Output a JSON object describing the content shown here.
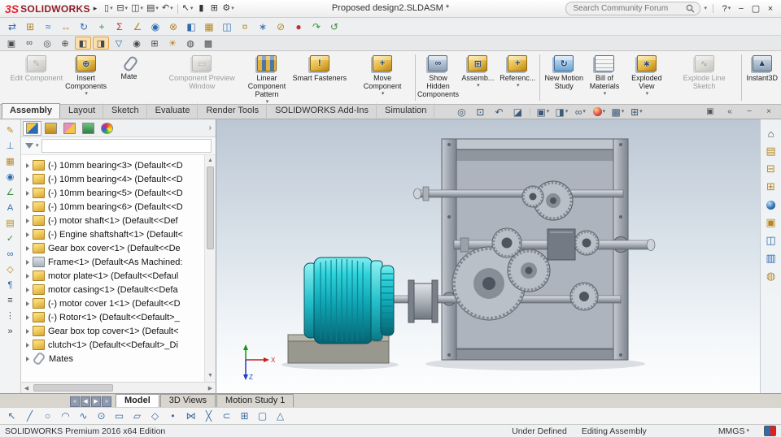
{
  "colors": {
    "accent_red": "#d6202e",
    "motor_teal": "#14b4c0",
    "housing_gray": "#adb4bd",
    "base_gray": "#98988f",
    "viewport_top": "#bcc7d4",
    "viewport_bottom": "#fdfefe"
  },
  "ui": {
    "caret": "▾",
    "chevron": "›"
  },
  "titlebar": {
    "logo": "3S",
    "brand": "SOLIDWORKS",
    "dock_arrow": "▸",
    "title": "Proposed design2.SLDASM *",
    "search_placeholder": "Search Community Forum",
    "quick_icons": [
      {
        "name": "new-icon",
        "glyph": "▯",
        "dd": true
      },
      {
        "name": "open-icon",
        "glyph": "⊟",
        "dd": true
      },
      {
        "name": "save-icon",
        "glyph": "◫",
        "dd": true
      },
      {
        "name": "print-icon",
        "glyph": "▤",
        "dd": true
      },
      {
        "name": "undo-icon",
        "glyph": "↶",
        "dd": true
      },
      {
        "sep": true
      },
      {
        "name": "select-icon",
        "glyph": "↖",
        "dd": true
      },
      {
        "name": "xpress-products-icon",
        "glyph": "▮",
        "mod": "c-dark"
      },
      {
        "name": "display-grid-icon",
        "glyph": "⊞"
      },
      {
        "name": "options-icon",
        "glyph": "⚙",
        "dd": true
      }
    ],
    "search_caret": "▾",
    "window_controls": [
      {
        "name": "help-icon",
        "glyph": "?",
        "dd": true
      },
      {
        "name": "minimize-icon",
        "glyph": "−"
      },
      {
        "name": "maximize-icon",
        "glyph": "▢"
      },
      {
        "name": "close-icon",
        "glyph": "×"
      }
    ]
  },
  "toolbar2": {
    "icons": [
      {
        "name": "swap-component-icon",
        "glyph": "⇄",
        "mod": "c-blue"
      },
      {
        "name": "insert-component-tb-icon",
        "glyph": "⊞",
        "mod": "c-gold"
      },
      {
        "name": "mate-tb-icon",
        "glyph": "≈",
        "mod": "c-blue"
      },
      {
        "name": "component-width-icon",
        "glyph": "↔",
        "mod": "c-gold"
      },
      {
        "name": "rotate-component-icon",
        "glyph": "↻",
        "mod": "c-blue"
      },
      {
        "name": "move-component-tb-icon",
        "glyph": "+",
        "mod": "c-green"
      },
      {
        "name": "equations-icon",
        "glyph": "Σ",
        "mod": "c-red"
      },
      {
        "name": "measure-icon",
        "glyph": "∠",
        "mod": "c-gold"
      },
      {
        "name": "mass-properties-icon",
        "glyph": "◉",
        "mod": "c-blue"
      },
      {
        "name": "interference-detection-icon",
        "glyph": "⊗",
        "mod": "c-gold"
      },
      {
        "name": "section-view-tb-icon",
        "glyph": "◧",
        "mod": "c-blue"
      },
      {
        "name": "pattern-icon",
        "glyph": "▦",
        "mod": "c-gold"
      },
      {
        "name": "mirror-components-icon",
        "glyph": "◫",
        "mod": "c-blue"
      },
      {
        "name": "smart-fasteners-tb-icon",
        "glyph": "¤",
        "mod": "c-gold"
      },
      {
        "name": "exploded-view-tb-icon",
        "glyph": "∗",
        "mod": "c-blue"
      },
      {
        "name": "hide-components-icon",
        "glyph": "⊘",
        "mod": "c-gold"
      },
      {
        "name": "appearance-icon",
        "glyph": "●",
        "mod": "c-red"
      },
      {
        "name": "motion-icon",
        "glyph": "↷",
        "mod": "c-green"
      },
      {
        "name": "rebuild-icon",
        "glyph": "↺",
        "mod": "c-green"
      }
    ]
  },
  "toolbar3": {
    "icons": [
      {
        "name": "arrange-icon",
        "glyph": "▣"
      },
      {
        "name": "link-view-icon",
        "glyph": "∞"
      },
      {
        "name": "zoom-tool-icon",
        "glyph": "◎"
      },
      {
        "name": "pan-icon",
        "glyph": "⊕"
      },
      {
        "name": "shaded-with-edges-icon",
        "glyph": "◧",
        "mod": "active"
      },
      {
        "name": "display-mode-icon",
        "glyph": "◨",
        "mod": "active"
      },
      {
        "name": "selection-filter-icon",
        "glyph": "▽",
        "mod": "c-blue"
      },
      {
        "name": "hide-show-icon",
        "glyph": "◉"
      },
      {
        "name": "grid-system-icon",
        "glyph": "⊞"
      },
      {
        "name": "lights-icon",
        "glyph": "☀",
        "mod": "c-gold"
      },
      {
        "name": "camera-icon",
        "glyph": "◍"
      },
      {
        "name": "scene-tb-icon",
        "glyph": "▩"
      }
    ]
  },
  "ribbon": {
    "buttons": [
      {
        "name": "edit-component-button",
        "label": "Edit Component",
        "icon": "edit-component-icon",
        "icon_glyph": "✎",
        "mod": "disabled"
      },
      {
        "name": "insert-components-button",
        "label": "Insert Components",
        "icon": "insert-components-icon",
        "icon_glyph": "⊕",
        "dd": true
      },
      {
        "name": "mate-button",
        "label": "Mate",
        "icon": "mate-icon",
        "icon_glyph": "",
        "mod": "ic-clip"
      },
      {
        "name": "component-preview-window-button",
        "label": "Component Preview Window",
        "icon": "component-preview-icon",
        "icon_glyph": "▭",
        "mod": "disabled"
      },
      {
        "name": "linear-component-pattern-button",
        "label": "Linear Component Pattern",
        "icon": "linear-component-pattern-icon",
        "icon_glyph": "",
        "mod": "ic-grid",
        "dd": true
      },
      {
        "name": "smart-fasteners-button",
        "label": "Smart Fasteners",
        "icon": "smart-fasteners-icon",
        "icon_glyph": "!",
        "dd": false
      },
      {
        "name": "move-component-button",
        "label": "Move Component",
        "icon": "move-component-icon",
        "icon_glyph": "+",
        "dd": true
      },
      {
        "sep": true
      },
      {
        "name": "show-hidden-components-button",
        "label": "Show Hidden Components",
        "icon": "show-hidden-components-icon",
        "icon_glyph": "∞",
        "mod": "ic-eye"
      },
      {
        "name": "assembly-features-button",
        "label": "Assemb...",
        "icon": "assembly-features-icon",
        "icon_glyph": "⊞",
        "dd": true
      },
      {
        "name": "reference-geometry-button",
        "label": "Referenc...",
        "icon": "reference-geometry-icon",
        "icon_glyph": "+",
        "dd": true
      },
      {
        "sep": true
      },
      {
        "name": "new-motion-study-button",
        "label": "New Motion Study",
        "icon": "new-motion-study-icon",
        "icon_glyph": "↻",
        "mod": "ic-motion"
      },
      {
        "name": "bill-of-materials-button",
        "label": "Bill of Materials",
        "icon": "bill-of-materials-icon",
        "icon_glyph": "",
        "mod": "ic-table",
        "dd": true
      },
      {
        "name": "exploded-view-button",
        "label": "Exploded View",
        "icon": "exploded-view-icon",
        "icon_glyph": "∗",
        "dd": true
      },
      {
        "name": "explode-line-sketch-button",
        "label": "Explode Line Sketch",
        "icon": "explode-line-sketch-icon",
        "icon_glyph": "∿",
        "mod": "disabled"
      },
      {
        "sep": true
      },
      {
        "name": "instant3d-button",
        "label": "Instant3D",
        "icon": "instant3d-icon",
        "icon_glyph": "▲",
        "mod": "ic-eye"
      }
    ]
  },
  "tabband": {
    "tabs": [
      {
        "name": "tab-assembly",
        "label": "Assembly",
        "mod": "active"
      },
      {
        "name": "tab-layout",
        "label": "Layout"
      },
      {
        "name": "tab-sketch",
        "label": "Sketch"
      },
      {
        "name": "tab-evaluate",
        "label": "Evaluate"
      },
      {
        "name": "tab-render-tools",
        "label": "Render Tools"
      },
      {
        "name": "tab-solidworks-add-ins",
        "label": "SOLIDWORKS Add-Ins"
      },
      {
        "name": "tab-simulation",
        "label": "Simulation"
      }
    ],
    "panel_controls": [
      {
        "name": "undock-pane-icon",
        "glyph": "▣"
      },
      {
        "name": "collapse-ribbon-icon",
        "glyph": "«"
      },
      {
        "name": "minimize-pane-icon",
        "glyph": "−"
      },
      {
        "name": "close-pane-icon",
        "glyph": "×"
      }
    ]
  },
  "headsup": {
    "icons": [
      {
        "name": "zoom-fit-icon",
        "glyph": "◎"
      },
      {
        "name": "zoom-area-icon",
        "glyph": "⊡"
      },
      {
        "name": "previous-view-icon",
        "glyph": "↶"
      },
      {
        "name": "section-view-icon",
        "glyph": "◪"
      },
      {
        "sep": true
      },
      {
        "name": "view-orientation-icon",
        "glyph": "▣",
        "dd": true
      },
      {
        "name": "display-style-icon",
        "glyph": "◨",
        "dd": true
      },
      {
        "name": "hide-show-items-icon",
        "glyph": "∞",
        "dd": true
      },
      {
        "name": "edit-appearance-icon",
        "glyph": "●",
        "mod": "c-ball-red",
        "dd": true
      },
      {
        "name": "apply-scene-icon",
        "glyph": "▩",
        "dd": true
      },
      {
        "name": "view-settings-icon",
        "glyph": "⊞",
        "dd": true
      }
    ]
  },
  "leftstrip": {
    "icons": [
      {
        "name": "sketch-strip-icon",
        "glyph": "✎",
        "mod": "c-gold"
      },
      {
        "name": "fixture-icon",
        "glyph": "⊥",
        "mod": "c-blue"
      },
      {
        "name": "part-strip-icon",
        "glyph": "▦",
        "mod": "c-gold"
      },
      {
        "name": "evaluate-icon",
        "glyph": "◉",
        "mod": "c-blue"
      },
      {
        "name": "dimension-icon",
        "glyph": "∠",
        "mod": "c-green"
      },
      {
        "name": "text-tool-icon",
        "glyph": "A",
        "mod": "c-blue"
      },
      {
        "name": "table-icon",
        "glyph": "▤",
        "mod": "c-gold"
      },
      {
        "name": "check-icon",
        "glyph": "✓",
        "mod": "c-green"
      },
      {
        "name": "mate-strip-icon",
        "glyph": "∞",
        "mod": "c-blue"
      },
      {
        "name": "box-icon",
        "glyph": "◇",
        "mod": "c-gold"
      },
      {
        "name": "note-icon",
        "glyph": "¶",
        "mod": "c-blue"
      },
      {
        "name": "layers-icon",
        "glyph": "≡"
      },
      {
        "name": "more-tools-icon",
        "glyph": "⋮"
      },
      {
        "name": "expand-strip-icon",
        "glyph": "»"
      }
    ]
  },
  "rightstrip": {
    "icons": [
      {
        "name": "home-icon",
        "glyph": "⌂"
      },
      {
        "name": "sheet-icon",
        "glyph": "▤",
        "mod": "c-gold"
      },
      {
        "name": "folder-icon",
        "glyph": "⊟",
        "mod": "c-gold"
      },
      {
        "name": "pattern-pane-icon",
        "glyph": "⊞",
        "mod": "c-gold"
      },
      {
        "name": "globe-icon",
        "glyph": "●",
        "mod": "c-ball-blue"
      },
      {
        "name": "clipboard-icon",
        "glyph": "▣",
        "mod": "c-gold"
      },
      {
        "name": "view-pane-icon",
        "glyph": "◫",
        "mod": "c-blue"
      },
      {
        "name": "properties-pane-icon",
        "glyph": "▥",
        "mod": "c-blue"
      },
      {
        "name": "custom-pane-icon",
        "glyph": "◍",
        "mod": "c-gold"
      }
    ]
  },
  "tree": {
    "filter_value": "",
    "scroll": {
      "up": "▲",
      "down": "▼",
      "left": "◀",
      "right": "▶"
    },
    "header_tabs": [
      {
        "name": "featuremanager-tab",
        "mod": "tt-fm active"
      },
      {
        "name": "propertymanager-tab",
        "mod": "tt-pm"
      },
      {
        "name": "configurationmanager-tab",
        "mod": "tt-cm"
      },
      {
        "name": "dimxpertmanager-tab",
        "mod": "tt-dx"
      },
      {
        "name": "displaymanager-tab",
        "mod": "tt-dm"
      }
    ],
    "items": [
      {
        "name": "tree-item-bearing-3",
        "icon": "part-icon",
        "label": "(-) 10mm bearing<3> (Default<<D"
      },
      {
        "name": "tree-item-bearing-4",
        "icon": "part-icon",
        "label": "(-) 10mm bearing<4> (Default<<D"
      },
      {
        "name": "tree-item-bearing-5",
        "icon": "part-icon",
        "label": "(-) 10mm bearing<5> (Default<<D"
      },
      {
        "name": "tree-item-bearing-6",
        "icon": "part-icon",
        "label": "(-) 10mm bearing<6> (Default<<D"
      },
      {
        "name": "tree-item-motor-shaft",
        "icon": "part-icon",
        "label": "(-) motor shaft<1> (Default<<Def"
      },
      {
        "name": "tree-item-engine-shaftshaft",
        "icon": "part-icon",
        "label": "(-) Engine shaftshaft<1> (Default<"
      },
      {
        "name": "tree-item-gear-box-cover",
        "icon": "part-icon",
        "label": "Gear box cover<1> (Default<<De"
      },
      {
        "name": "tree-item-frame",
        "icon": "frame-part-icon",
        "mod": "icon-steel",
        "label": "Frame<1> (Default<As Machined:"
      },
      {
        "name": "tree-item-motor-plate",
        "icon": "part-icon",
        "label": "motor plate<1> (Default<<Defaul"
      },
      {
        "name": "tree-item-motor-casing",
        "icon": "part-icon",
        "label": "motor casing<1> (Default<<Defa"
      },
      {
        "name": "tree-item-motor-cover",
        "icon": "part-icon",
        "label": "(-) motor cover 1<1> (Default<<D"
      },
      {
        "name": "tree-item-rotor",
        "icon": "part-icon",
        "label": "(-) Rotor<1> (Default<<Default>_"
      },
      {
        "name": "tree-item-gear-box-top-cover",
        "icon": "part-icon",
        "label": "Gear box top cover<1> (Default<"
      },
      {
        "name": "tree-item-clutch",
        "icon": "part-icon",
        "label": "clutch<1> (Default<<Default>_Di"
      },
      {
        "name": "tree-item-mates",
        "icon": "mates-folder-icon",
        "mod": "icon-mates",
        "label": "Mates"
      }
    ]
  },
  "viewport": {
    "axis_x": "X",
    "axis_z": "Z"
  },
  "doctabs": {
    "scroll": [
      {
        "name": "tab-scroll-first-icon",
        "glyph": "«"
      },
      {
        "name": "tab-scroll-prev-icon",
        "glyph": "◀"
      },
      {
        "name": "tab-scroll-next-icon",
        "glyph": "▶"
      },
      {
        "name": "tab-scroll-last-icon",
        "glyph": "»"
      }
    ],
    "tabs": [
      {
        "name": "tab-model",
        "label": "Model",
        "mod": "active"
      },
      {
        "name": "tab-3d-views",
        "label": "3D Views"
      },
      {
        "name": "tab-motion-study-1",
        "label": "Motion Study 1"
      }
    ]
  },
  "sketchbar": {
    "icons": [
      {
        "name": "select-arrow-icon",
        "glyph": "↖"
      },
      {
        "name": "line-icon",
        "glyph": "╱"
      },
      {
        "name": "circle-icon",
        "glyph": "○"
      },
      {
        "name": "arc-icon",
        "glyph": "◠"
      },
      {
        "name": "spline-icon",
        "glyph": "∿"
      },
      {
        "name": "ellipse-icon",
        "glyph": "⊙"
      },
      {
        "name": "rectangle-icon",
        "glyph": "▭"
      },
      {
        "name": "slot-icon",
        "glyph": "▱"
      },
      {
        "name": "polygon-icon",
        "glyph": "◇"
      },
      {
        "name": "point-icon",
        "glyph": "•"
      },
      {
        "name": "mirror-entities-icon",
        "glyph": "⋈"
      },
      {
        "name": "trim-entities-icon",
        "glyph": "╳"
      },
      {
        "name": "convert-entities-icon",
        "glyph": "⊂"
      },
      {
        "name": "sketch-grid-icon",
        "glyph": "⊞"
      },
      {
        "name": "viewport-border-icon",
        "glyph": "▢"
      },
      {
        "name": "balloon-icon",
        "glyph": "△"
      }
    ]
  },
  "status": {
    "edition": "SOLIDWORKS Premium 2016 x64 Edition",
    "constraint": "Under Defined",
    "mode": "Edit­ing Assembly",
    "mode_text": "Editing Assembly",
    "units": "MMGS"
  }
}
